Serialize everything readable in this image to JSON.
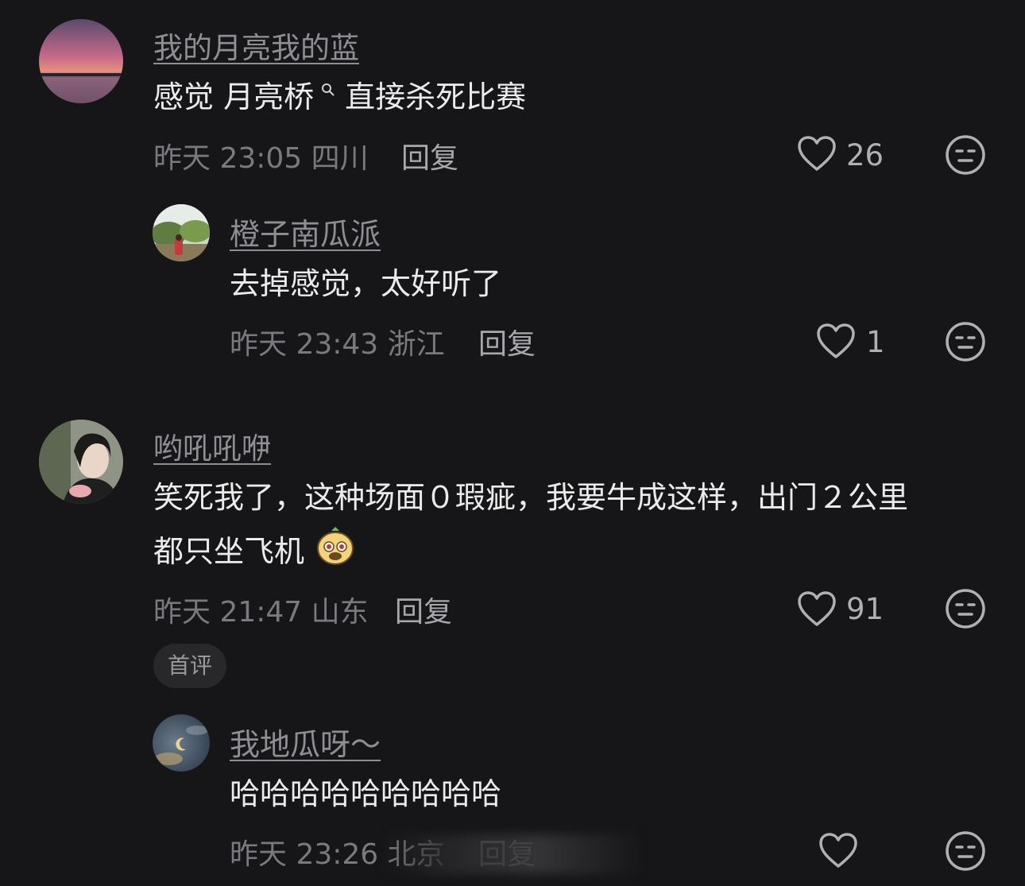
{
  "comments": [
    {
      "username": "我的月亮我的蓝",
      "text": "感觉 月亮桥",
      "text_after": " 直接杀死比赛",
      "meta": "昨天 23:05 四川",
      "reply_label": "回复",
      "likes": "26",
      "replies": [
        {
          "username": "橙子南瓜派",
          "text": "去掉感觉，太好听了",
          "meta": "昨天 23:43 浙江",
          "reply_label": "回复",
          "likes": "1"
        }
      ]
    },
    {
      "username": "哟吼吼咿",
      "text_line1": "笑死我了，这种场面０瑕疵，我要牛成这样，出门２公里",
      "text_line2": "都只坐飞机",
      "meta": "昨天 21:47 山东",
      "reply_label": "回复",
      "likes": "91",
      "badge": "首评",
      "replies": [
        {
          "username": "我地瓜呀～",
          "text": "哈哈哈哈哈哈哈哈哈",
          "meta": "昨天 23:26 北京",
          "reply_label": "回复",
          "likes": ""
        }
      ]
    }
  ],
  "icons": {
    "like": "heart-outline-icon",
    "dislike": "meh-face-icon",
    "search": "search-icon",
    "emoji": "dog-sticker-emoji"
  },
  "colors": {
    "background": "#161618",
    "username": "#8e8e93",
    "text": "#ebebeb",
    "meta": "#7a7a7e",
    "badge_bg": "#28282b"
  }
}
